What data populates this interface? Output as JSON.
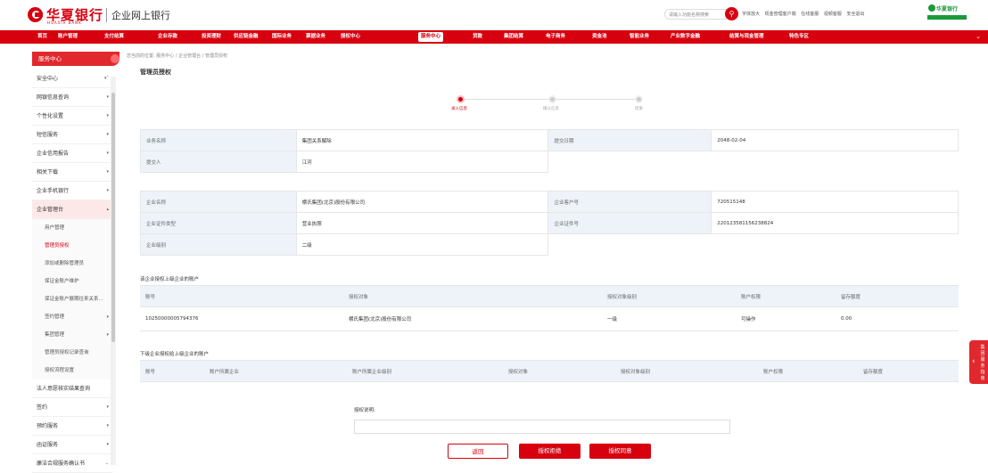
{
  "header": {
    "logo_cn": "华夏银行",
    "logo_en": "HUAXIA BANK",
    "subtitle": "企业网上银行",
    "search_placeholder": "请输入功能名称搜索",
    "links": [
      "字体放大",
      "现金管理客户端",
      "在线客服",
      "视频客服",
      "安全退出"
    ],
    "brand_right": "华夏银行"
  },
  "nav": {
    "items": [
      "首页",
      "账户管理",
      "支付结算",
      "企业存款",
      "投资理财",
      "供应链金融",
      "国际业务",
      "票据业务",
      "授权中心",
      "服务中心",
      "贷款",
      "集团结算",
      "电子商务",
      "资金池",
      "智能业务",
      "产业数字金融",
      "结算与现金管理",
      "特色专区"
    ],
    "active": "服务中心"
  },
  "sidebar": {
    "title": "服务中心",
    "items": [
      {
        "label": "安全中心"
      },
      {
        "label": "网银信息查询"
      },
      {
        "label": "个性化设置"
      },
      {
        "label": "短信服务"
      },
      {
        "label": "企业信用报告"
      },
      {
        "label": "相关下载"
      },
      {
        "label": "企业手机银行"
      },
      {
        "label": "企业管理台"
      }
    ],
    "sub_items": [
      {
        "label": "用户管理"
      },
      {
        "label": "管理员授权"
      },
      {
        "label": "添加或删除管理员"
      },
      {
        "label": "保证金账户维护"
      },
      {
        "label": "保证金账户展期往来关系..."
      },
      {
        "label": "签约管理"
      },
      {
        "label": "集团管理"
      },
      {
        "label": "管理员授权记录查询"
      },
      {
        "label": "授权流程设置"
      }
    ],
    "bottom_items": [
      {
        "label": "法人意愿核实结果查询"
      },
      {
        "label": "签约"
      },
      {
        "label": "预约服务"
      },
      {
        "label": "函证服务"
      },
      {
        "label": "廉洁合规服务确认书"
      }
    ]
  },
  "breadcrumb": "您当前的位置: 服务中心 / 企业管理台 / 管理员授权",
  "page_title": "管理员授权",
  "steps": [
    "录入信息",
    "确认信息",
    "结果"
  ],
  "info1": {
    "biz_name_label": "业务名称",
    "biz_name": "集团关系解除",
    "submit_date_label": "提交日期",
    "submit_date": "2048-02-04",
    "submitter_label": "提交人",
    "submitter": "江河"
  },
  "info2": {
    "corp_name_label": "企业名称",
    "corp_name": "横氏集团(北京)股份有限公司",
    "corp_cust_label": "企业客户号",
    "corp_cust": "720515148",
    "cert_type_label": "企业证件类型",
    "cert_type": "营业执照",
    "cert_no_label": "企业证件号",
    "cert_no": "220123581156238824",
    "level_label": "企业级别",
    "level": "二级"
  },
  "upper": {
    "title": "该企业授权上级企业的账户",
    "headers": [
      "账号",
      "授权对象",
      "授权对象级别",
      "账户权限",
      "留存额度"
    ],
    "rows": [
      [
        "10250000005794376",
        "横氏集团(北京)股份有限公司",
        "一级",
        "可操作",
        "0.00"
      ]
    ]
  },
  "lower": {
    "title": "下级企业授权给上级企业的账户",
    "headers": [
      "账号",
      "账户所属企业",
      "账户所属企业级别",
      "授权对象",
      "授权对象级别",
      "账户权限",
      "留存额度"
    ]
  },
  "remark_label": "授权说明:",
  "buttons": {
    "back": "返回",
    "reject": "授权拒绝",
    "agree": "授权同意"
  },
  "float_side": "集团服务指南"
}
